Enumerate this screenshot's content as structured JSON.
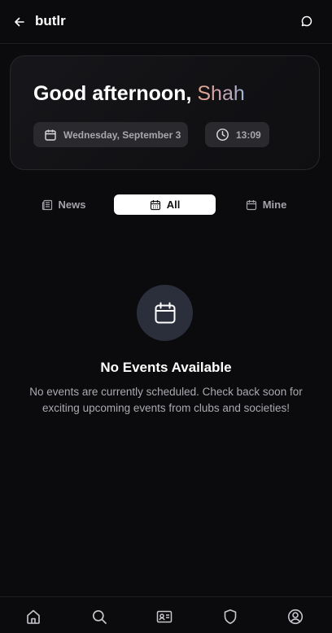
{
  "header": {
    "title": "butlr",
    "back_icon": "arrow-left-icon",
    "chat_icon": "chat-bubble-icon"
  },
  "greeting": {
    "salutation": "Good afternoon,",
    "name": "Shah",
    "date": "Wednesday, September 3",
    "time": "13:09"
  },
  "tabs": [
    {
      "label": "News",
      "icon": "newspaper-icon",
      "selected": false
    },
    {
      "label": "All",
      "icon": "calendar-icon",
      "selected": true
    },
    {
      "label": "Mine",
      "icon": "calendar-icon",
      "selected": false
    }
  ],
  "empty_state": {
    "icon": "calendar-icon",
    "title": "No Events Available",
    "description": "No events are currently scheduled. Check back soon for exciting upcoming events from clubs and societies!"
  },
  "bottom_nav": [
    "home-icon",
    "search-icon",
    "id-card-icon",
    "shield-icon",
    "profile-icon"
  ],
  "colors": {
    "background": "#0b0b0d",
    "pill": "#2a2a2e",
    "selected_tab": "#ffffff",
    "icon_circle": "#2a2f3b"
  }
}
